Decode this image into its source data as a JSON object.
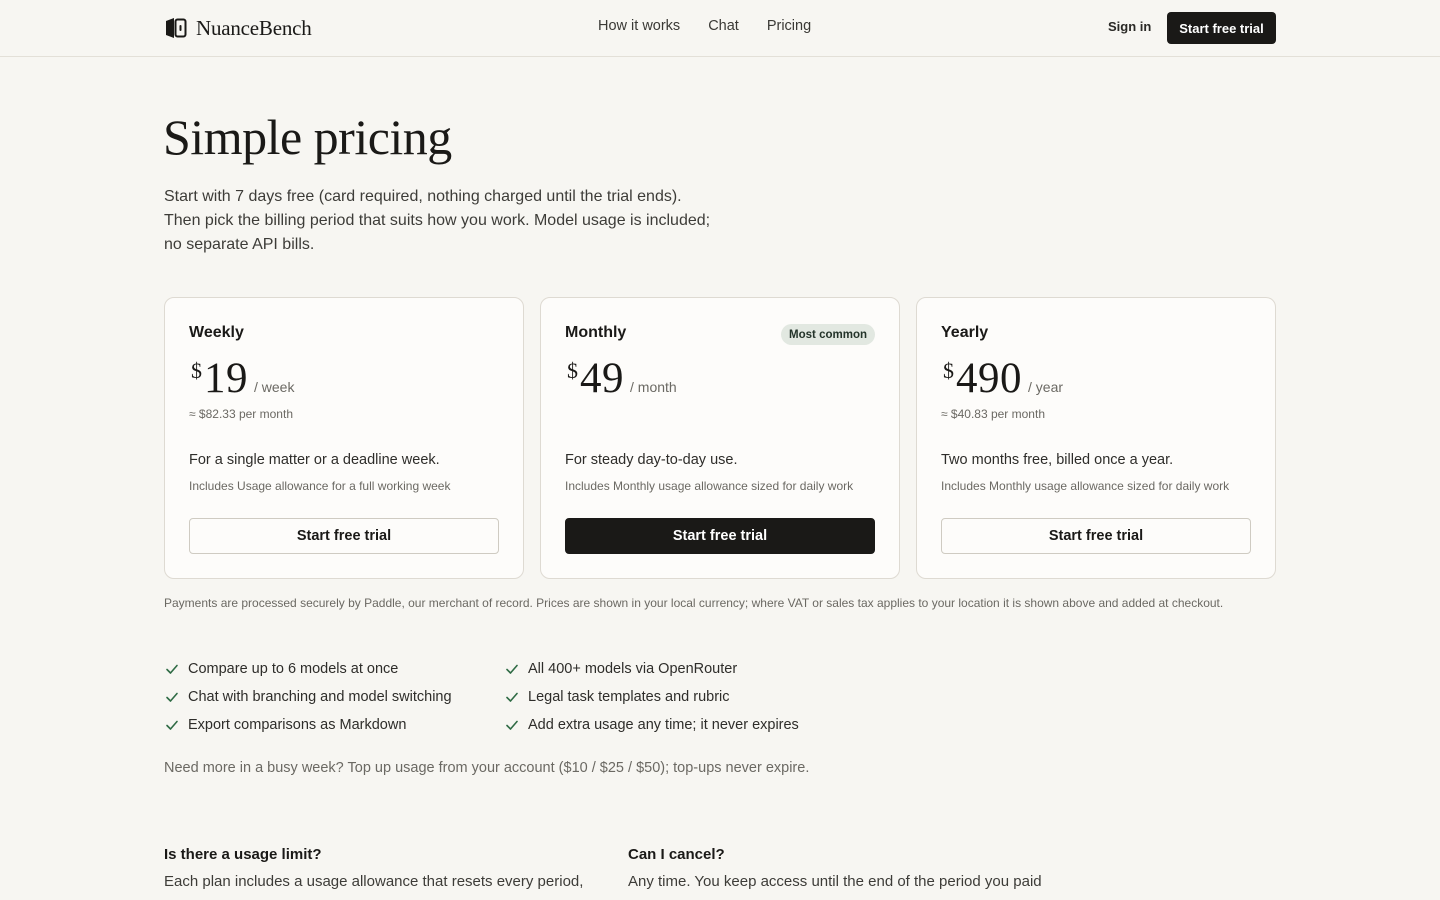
{
  "header": {
    "brand": "NuanceBench",
    "nav": [
      {
        "label": "How it works"
      },
      {
        "label": "Chat"
      },
      {
        "label": "Pricing"
      }
    ],
    "sign_in": "Sign in",
    "cta": "Start free trial"
  },
  "hero": {
    "title": "Simple pricing",
    "subtitle_lines": [
      "Start with 7 days free (card required, nothing charged until the trial ends).",
      "Then pick the billing period that suits how you work. Model usage is included;",
      "no separate API bills."
    ]
  },
  "plans": [
    {
      "name": "Weekly",
      "badge": "",
      "currency": "$",
      "amount": "19",
      "period": "/ week",
      "per_month": "≈ $82.33 per month",
      "description": "For a single matter or a deadline week.",
      "includes": "Includes Usage allowance for a full working week",
      "button": "Start free trial"
    },
    {
      "name": "Monthly",
      "badge": "Most common",
      "currency": "$",
      "amount": "49",
      "period": "/ month",
      "per_month": "",
      "description": "For steady day-to-day use.",
      "includes": "Includes Monthly usage allowance sized for daily work",
      "button": "Start free trial"
    },
    {
      "name": "Yearly",
      "badge": "",
      "currency": "$",
      "amount": "490",
      "period": "/ year",
      "per_month": "≈ $40.83 per month",
      "description": "Two months free, billed once a year.",
      "includes": "Includes Monthly usage allowance sized for daily work",
      "button": "Start free trial"
    }
  ],
  "payment_note": "Payments are processed securely by Paddle, our merchant of record. Prices are shown in your local currency; where VAT or sales tax applies to your location it is shown above and added at checkout.",
  "features": [
    "Compare up to 6 models at once",
    "Chat with branching and model switching",
    "Export comparisons as Markdown",
    "All 400+ models via OpenRouter",
    "Legal task templates and rubric",
    "Add extra usage any time; it never expires"
  ],
  "topup_note": "Need more in a busy week? Top up usage from your account ($10 / $25 / $50); top-ups never expire.",
  "faq": [
    {
      "question": "Is there a usage limit?",
      "answer": "Each plan includes a usage allowance that resets every period,"
    },
    {
      "question": "Can I cancel?",
      "answer": "Any time. You keep access until the end of the period you paid"
    }
  ],
  "colors": {
    "background": "#f7f6f2",
    "primary": "#1a1917",
    "badge_bg": "#e2e8e1",
    "check": "#2f6b45"
  }
}
